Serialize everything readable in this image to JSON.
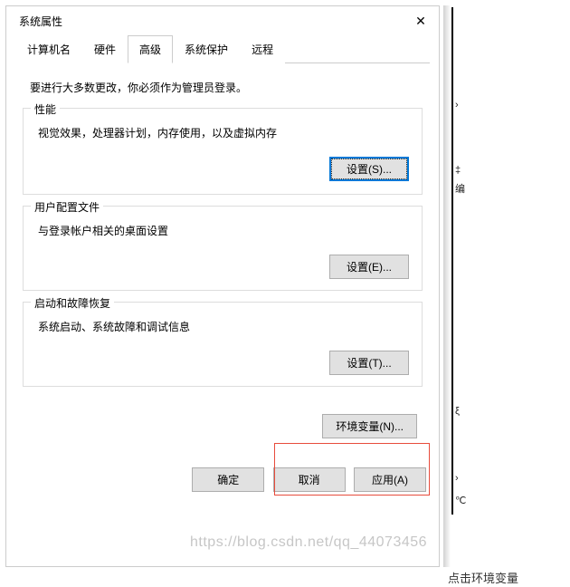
{
  "dialog": {
    "title": "系统属性",
    "close_glyph": "✕"
  },
  "tabs": {
    "computer_name": "计算机名",
    "hardware": "硬件",
    "advanced": "高级",
    "system_protection": "系统保护",
    "remote": "远程"
  },
  "instruction": "要进行大多数更改，你必须作为管理员登录。",
  "performance": {
    "legend": "性能",
    "desc": "视觉效果，处理器计划，内存使用，以及虚拟内存",
    "button": "设置(S)..."
  },
  "userprofile": {
    "legend": "用户配置文件",
    "desc": "与登录帐户相关的桌面设置",
    "button": "设置(E)..."
  },
  "startup": {
    "legend": "启动和故障恢复",
    "desc": "系统启动、系统故障和调试信息",
    "button": "设置(T)..."
  },
  "envvar": {
    "button": "环境变量(N)..."
  },
  "footer": {
    "ok": "确定",
    "cancel": "取消",
    "apply": "应用(A)"
  },
  "caption": "点击环境变量",
  "watermark": "https://blog.csdn.net/qq_44073456"
}
